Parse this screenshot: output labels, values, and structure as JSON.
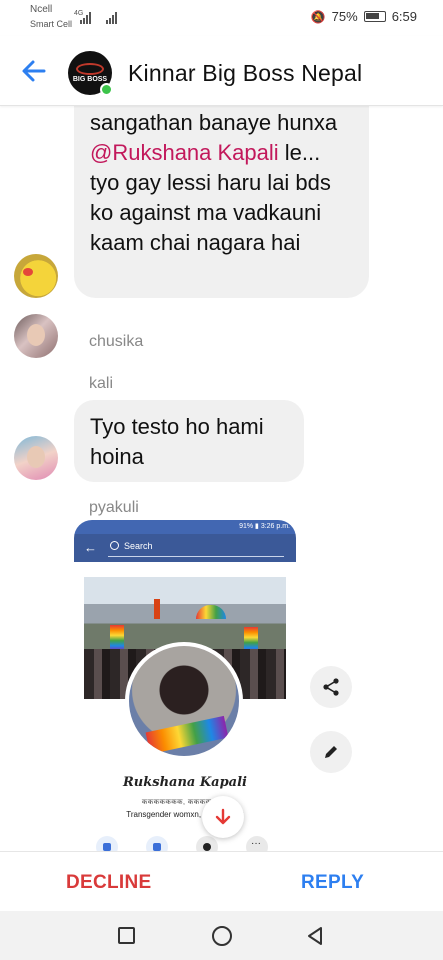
{
  "status_bar": {
    "carrier1": "Ncell",
    "carrier2": "Smart Cell",
    "network": "4G",
    "battery": "75%",
    "time": "6:59"
  },
  "header": {
    "title": "Kinnar Big Boss Nepal",
    "avatar_text": "BIG BOSS"
  },
  "messages": {
    "first": {
      "pre": "sangathan banaye hunxa ",
      "mention": "@Rukshana Kapali",
      "post": " le... tyo gay lessi haru lai bds ko against ma vadkauni kaam chai nagara hai"
    },
    "sender_chusika": "chusika",
    "sender_kali": "kali",
    "kali_text": "Tyo testo ho hami hoina",
    "sender_pyakuli": "pyakuli"
  },
  "shared_image": {
    "status_text": "91% ▮ 3:26 p.m.",
    "search_label": "Search",
    "profile_name": "Rukshana Kapali",
    "profile_line1": "ककककककक, ककककक, क",
    "profile_line2": "Transgender womxn, B… Activist"
  },
  "actions": {
    "decline": "DECLINE",
    "reply": "REPLY"
  },
  "colors": {
    "mention": "#c2185b",
    "decline": "#d93a3a",
    "reply": "#2d7ff0",
    "back_arrow": "#2d7ff0",
    "online": "#3cc44a"
  },
  "icons": [
    "back-arrow-icon",
    "share-icon",
    "edit-icon",
    "scroll-down-icon",
    "nav-recents-icon",
    "nav-home-icon",
    "nav-back-icon"
  ]
}
